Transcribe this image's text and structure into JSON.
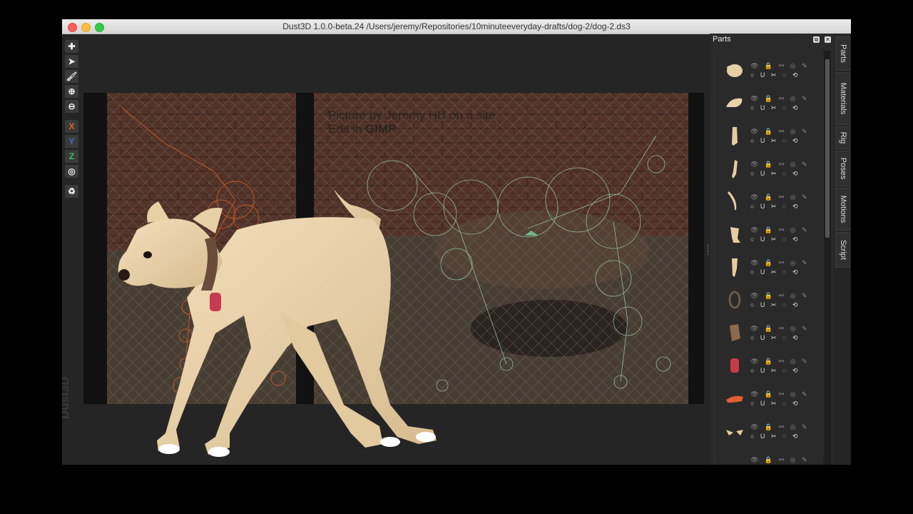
{
  "window": {
    "title": "Dust3D 1.0.0-beta.24 /Users/jeremy/Repositories/10minuteeveryday-drafts/dog-2/dog-2.ds3"
  },
  "toolbar": {
    "tools": [
      {
        "name": "add-icon",
        "glyph": "✚"
      },
      {
        "name": "select-arrow-icon",
        "glyph": "➤"
      },
      {
        "name": "paint-brush-icon",
        "glyph": "🖌"
      },
      {
        "name": "zoom-in-icon",
        "glyph": "⊕"
      },
      {
        "name": "zoom-out-icon",
        "glyph": "⊖"
      }
    ],
    "axis_x": "X",
    "axis_y": "Y",
    "axis_z": "Z",
    "axis_colors": {
      "x": "#e0622a",
      "y": "#3a6fc2",
      "z": "#3fbf5a"
    },
    "radius_icon": "◎",
    "recycle_icon": "♻"
  },
  "canvas": {
    "credit_line1": "Picture by Jeremy HU on a site",
    "credit_line2_prefix": "Edit in ",
    "credit_line2_bold": "GIMP",
    "watermark": "Dust3D"
  },
  "parts_panel": {
    "title": "Parts",
    "float_button": "⧉",
    "close_button": "✕",
    "row_icons_top": "👁 🔒 ⚯ ◎ ✎",
    "row_icons_bottom": "○ U ✂ ◌ ⟲",
    "parts": [
      {
        "shape": "head",
        "color": "#e6cfa6"
      },
      {
        "shape": "snout",
        "color": "#e8d2aa"
      },
      {
        "shape": "leg",
        "color": "#e6cca0"
      },
      {
        "shape": "leg2",
        "color": "#e6cca0"
      },
      {
        "shape": "tail",
        "color": "#e6cca0"
      },
      {
        "shape": "leg3",
        "color": "#e6cca0"
      },
      {
        "shape": "leg4",
        "color": "#e6cca0"
      },
      {
        "shape": "collar",
        "color": "#6b5a48"
      },
      {
        "shape": "block",
        "color": "#8c6a4e"
      },
      {
        "shape": "tag",
        "color": "#c83a4a"
      },
      {
        "shape": "tongue",
        "color": "#e06030"
      },
      {
        "shape": "ears",
        "color": "#e6cca0"
      },
      {
        "shape": "partial",
        "color": "#6b5a48"
      }
    ]
  },
  "side_tabs": [
    "Parts",
    "Materials",
    "Rig",
    "Poses",
    "Motions",
    "Script"
  ]
}
